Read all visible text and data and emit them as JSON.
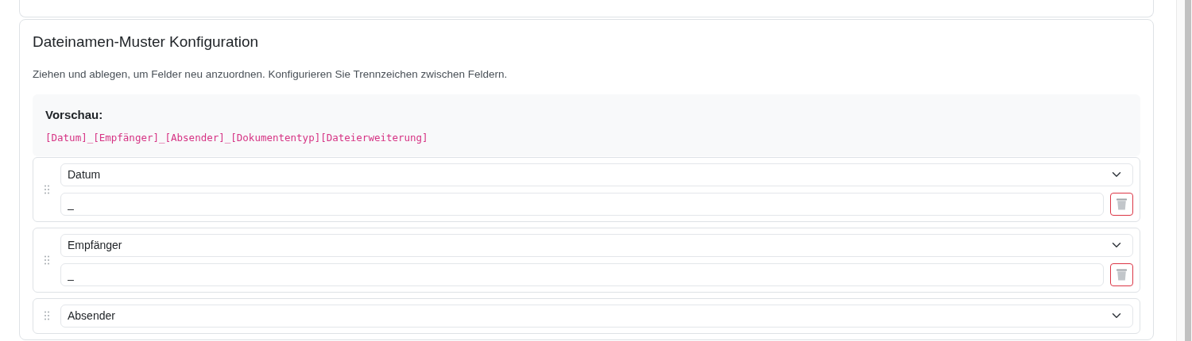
{
  "section": {
    "title": "Dateinamen-Muster Konfiguration",
    "description": "Ziehen und ablegen, um Felder neu anzuordnen. Konfigurieren Sie Trennzeichen zwischen Feldern.",
    "preview": {
      "label": "Vorschau:",
      "pattern": "[Datum]_[Empfänger]_[Absender]_[Dokumententyp][Dateierweiterung]"
    },
    "fields": [
      {
        "field": "Datum",
        "separator": "_"
      },
      {
        "field": "Empfänger",
        "separator": "_"
      },
      {
        "field": "Absender"
      }
    ]
  }
}
